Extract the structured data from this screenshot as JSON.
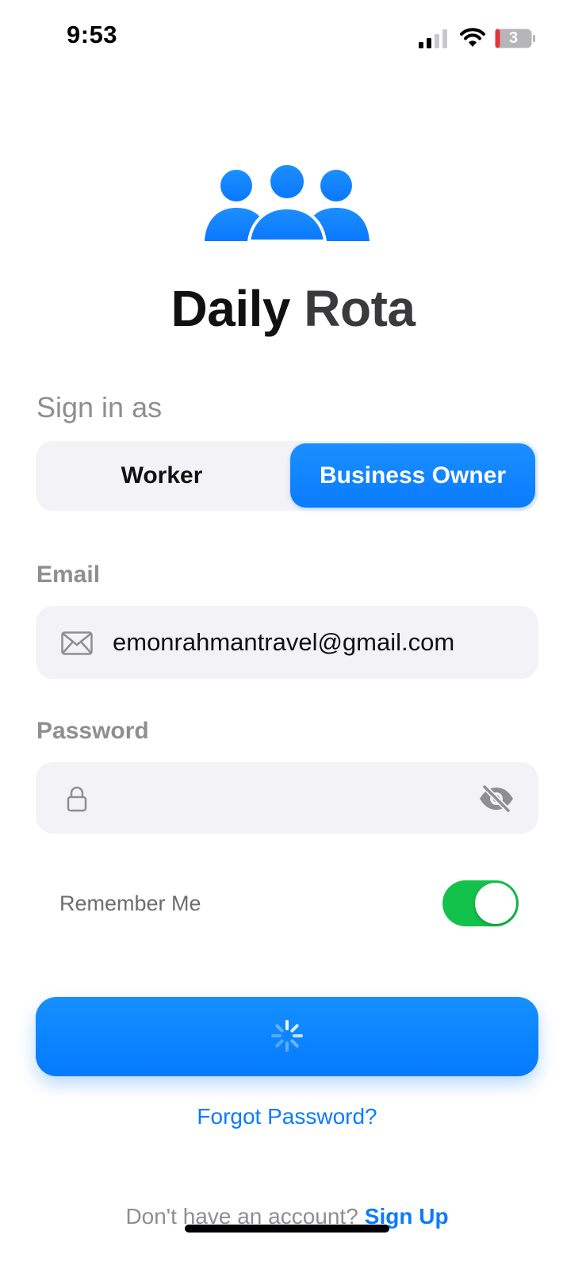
{
  "status_bar": {
    "time": "9:53",
    "battery_level": "3",
    "icons": [
      "cellular-signal-icon",
      "wifi-icon",
      "battery-icon"
    ]
  },
  "app": {
    "title_part1": "Daily ",
    "title_part2": "Rota",
    "logo_icon": "people-group-icon",
    "accent_color": "#0A7BFF"
  },
  "sign_in": {
    "label": "Sign in as",
    "options": [
      "Worker",
      "Business Owner"
    ],
    "selected": "Business Owner"
  },
  "form": {
    "email_label": "Email",
    "email_value": "emonrahmantravel@gmail.com",
    "password_label": "Password",
    "password_value": "",
    "remember_label": "Remember Me",
    "remember_on": true
  },
  "actions": {
    "signin_state": "loading",
    "forgot_password": "Forgot Password?",
    "no_account_text": "Don't have an account?",
    "signup_link": "Sign Up"
  }
}
